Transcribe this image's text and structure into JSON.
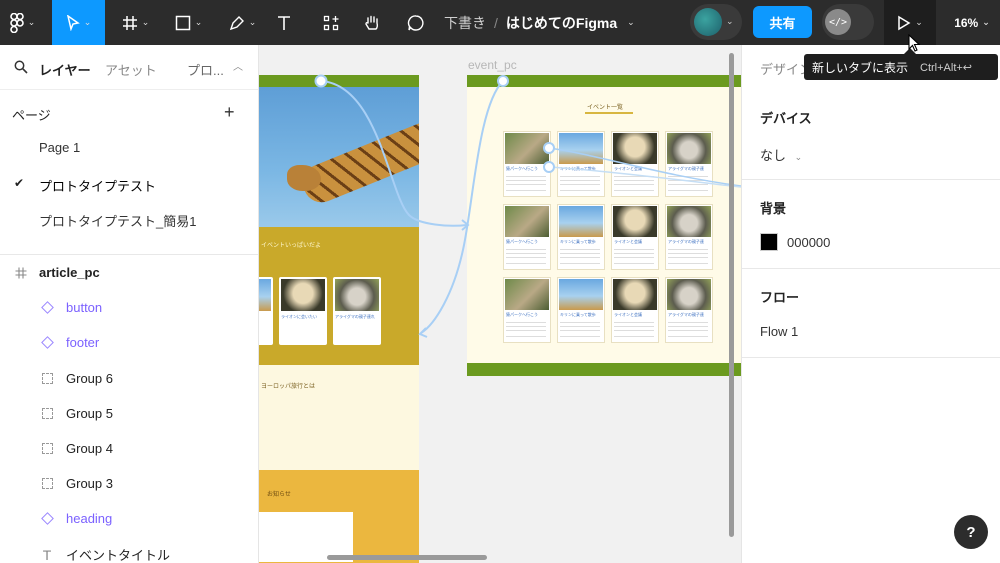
{
  "toolbar": {
    "zoom_label": "16%",
    "share_label": "共有",
    "draft_label": "下書き",
    "separator": "/",
    "file_name": "はじめてのFigma",
    "dev_mode_glyph": "</>"
  },
  "tooltip": {
    "label": "新しいタブに表示",
    "shortcut": "Ctrl+Alt+↩"
  },
  "left_panel": {
    "tabs": {
      "layers": "レイヤー",
      "assets": "アセット",
      "proto": "プロ..."
    },
    "pages_header": "ページ",
    "pages": [
      {
        "label": "Page 1",
        "selected": false
      },
      {
        "label": "プロトタイプテスト",
        "selected": true
      },
      {
        "label": "プロトタイプテスト_簡易1",
        "selected": false
      }
    ],
    "layers": [
      {
        "label": "article_pc",
        "icon": "frame-icon"
      },
      {
        "label": "button",
        "icon": "component-icon"
      },
      {
        "label": "footer",
        "icon": "component-icon"
      },
      {
        "label": "Group 6",
        "icon": "group-icon"
      },
      {
        "label": "Group 5",
        "icon": "group-icon"
      },
      {
        "label": "Group 4",
        "icon": "group-icon"
      },
      {
        "label": "Group 3",
        "icon": "group-icon"
      },
      {
        "label": "heading",
        "icon": "component-icon"
      },
      {
        "label": "イベントタイトル",
        "icon": "text-icon"
      }
    ]
  },
  "canvas": {
    "frame_label": "event_pc",
    "event_title": "イベント一覧",
    "left_frame_texts": [
      "イベントいっぱいだよ",
      "ヨーロッパ旅行とは",
      "お知らせ",
      "ライオンに会いたい",
      "アライグマの親子連れ"
    ],
    "card_titles": [
      "猿パークへ行こう",
      "キリンに乗って散歩",
      "ライオンと会議",
      "アライグマの親子連"
    ]
  },
  "right_panel": {
    "design_tab": "デザイン",
    "device_header": "デバイス",
    "device_value": "なし",
    "background_header": "背景",
    "background_hex": "000000",
    "flow_header": "フロー",
    "flow_value": "Flow 1"
  },
  "help_label": "?",
  "colors": {
    "toolbar_bg": "#2c2c2c",
    "accent": "#0d99ff",
    "component": "#7b61ff",
    "prototype_line": "#a8cff5"
  }
}
